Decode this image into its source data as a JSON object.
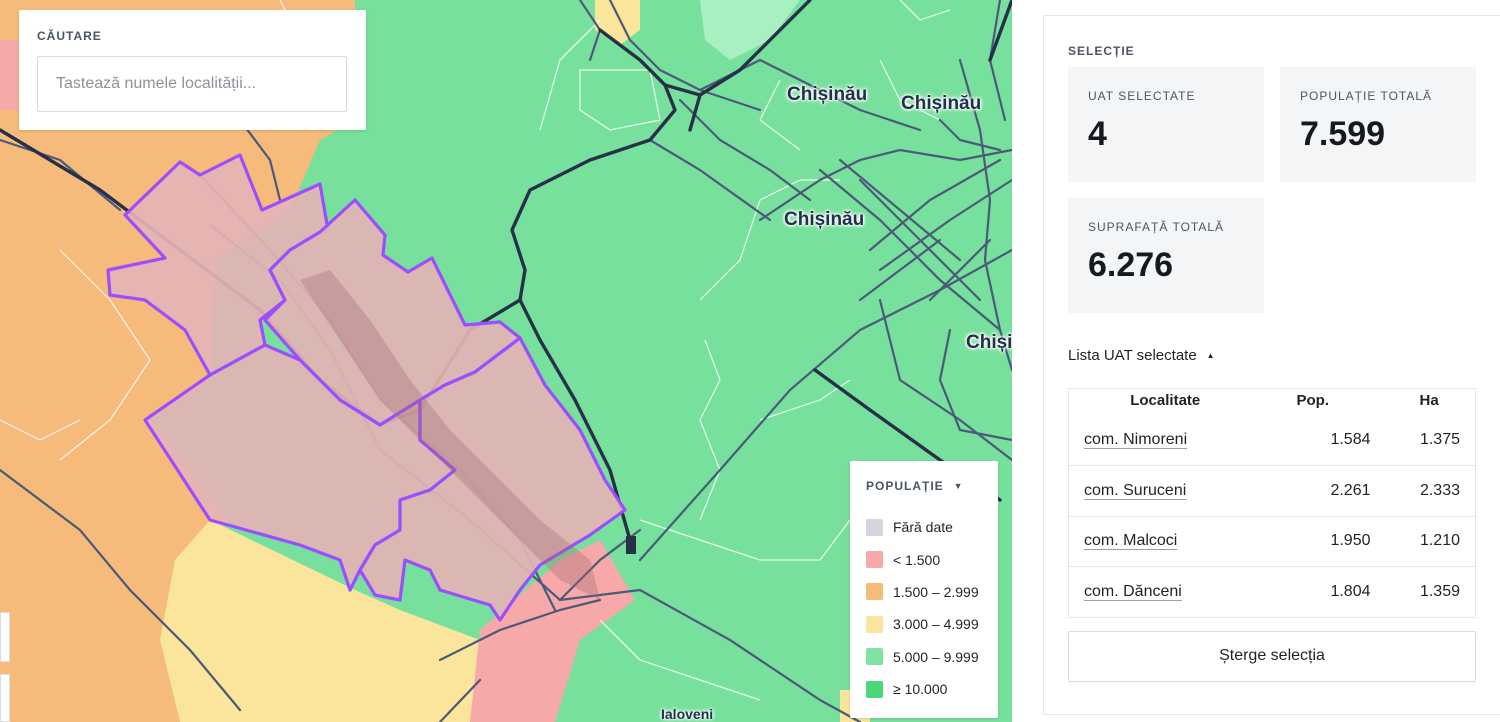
{
  "search": {
    "label": "CĂUTARE",
    "placeholder": "Tastează numele localității..."
  },
  "map": {
    "labels": {
      "city1": "Chișinău",
      "city2": "Chișinău",
      "city3": "Chișinău",
      "city4": "Chiși",
      "town": "Ialoveni"
    },
    "legend": {
      "title": "POPULAȚIE",
      "items": [
        {
          "label": "Fără date",
          "color": "#d3d6db"
        },
        {
          "label": "< 1.500",
          "color": "#f7a8a8"
        },
        {
          "label": "1.500 – 2.999",
          "color": "#f6bb7a"
        },
        {
          "label": "3.000 – 4.999",
          "color": "#fbe49c"
        },
        {
          "label": "5.000 – 9.999",
          "color": "#7fe4a3"
        },
        {
          "label": "≥ 10.000",
          "color": "#4cd67c"
        }
      ]
    },
    "selection_color": "#9b4dff"
  },
  "panel": {
    "section": "SELECȚIE",
    "stats": {
      "uat_label": "UAT SELECTATE",
      "uat_value": "4",
      "pop_label": "POPULAȚIE TOTALĂ",
      "pop_value": "7.599",
      "area_label": "SUPRAFAȚĂ TOTALĂ",
      "area_value": "6.276"
    },
    "list_title": "Lista UAT selectate",
    "columns": {
      "loc": "Localitate",
      "pop": "Pop.",
      "ha": "Ha"
    },
    "rows": [
      {
        "name": "com. Nimoreni",
        "pop": "1.584",
        "ha": "1.375"
      },
      {
        "name": "com. Suruceni",
        "pop": "2.261",
        "ha": "2.333"
      },
      {
        "name": "com. Malcoci",
        "pop": "1.950",
        "ha": "1.210"
      },
      {
        "name": "com. Dănceni",
        "pop": "1.804",
        "ha": "1.359"
      }
    ],
    "clear": "Șterge selecția"
  }
}
